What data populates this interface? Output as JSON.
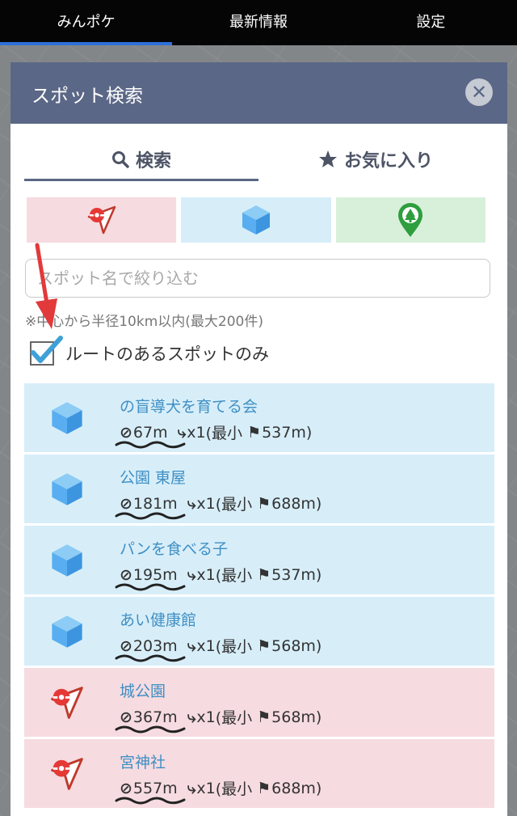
{
  "nav": {
    "tabs": [
      {
        "label": "みんポケ"
      },
      {
        "label": "最新情報"
      },
      {
        "label": "設定"
      }
    ]
  },
  "modal": {
    "title": "スポット検索",
    "close_label": "✕",
    "tabs": {
      "search": "検索",
      "favorites": "お気に入り"
    },
    "search": {
      "placeholder": "スポット名で絞り込む",
      "value": ""
    },
    "note": "※中心から半径10km以内(最大200件)",
    "filter_checkbox": {
      "label": "ルートのあるスポットのみ",
      "checked": true
    }
  },
  "results": [
    {
      "type": "gym",
      "name": "の盲導犬を育てる会",
      "distance": "67m",
      "routes": "x1",
      "min_prefix": "(最小",
      "min": "537m)"
    },
    {
      "type": "gym",
      "name": "公園 東屋",
      "distance": "181m",
      "routes": "x1",
      "min_prefix": "(最小",
      "min": "688m)"
    },
    {
      "type": "gym",
      "name": "パンを食べる子",
      "distance": "195m",
      "routes": "x1",
      "min_prefix": "(最小",
      "min": "537m)"
    },
    {
      "type": "gym",
      "name": "あい健康館",
      "distance": "203m",
      "routes": "x1",
      "min_prefix": "(最小",
      "min": "568m)"
    },
    {
      "type": "stop",
      "name": "城公園",
      "distance": "367m",
      "routes": "x1",
      "min_prefix": "(最小",
      "min": "568m)"
    },
    {
      "type": "stop",
      "name": "宮神社",
      "distance": "557m",
      "routes": "x1",
      "min_prefix": "(最小",
      "min": "688m)"
    }
  ],
  "colors": {
    "header": "#5b6786",
    "gym_row": "#d7eef9",
    "stop_row": "#f6dbe0",
    "park_filter": "#d8f0d9",
    "link": "#3f8fc4",
    "annotation_arrow": "#e2393b"
  }
}
